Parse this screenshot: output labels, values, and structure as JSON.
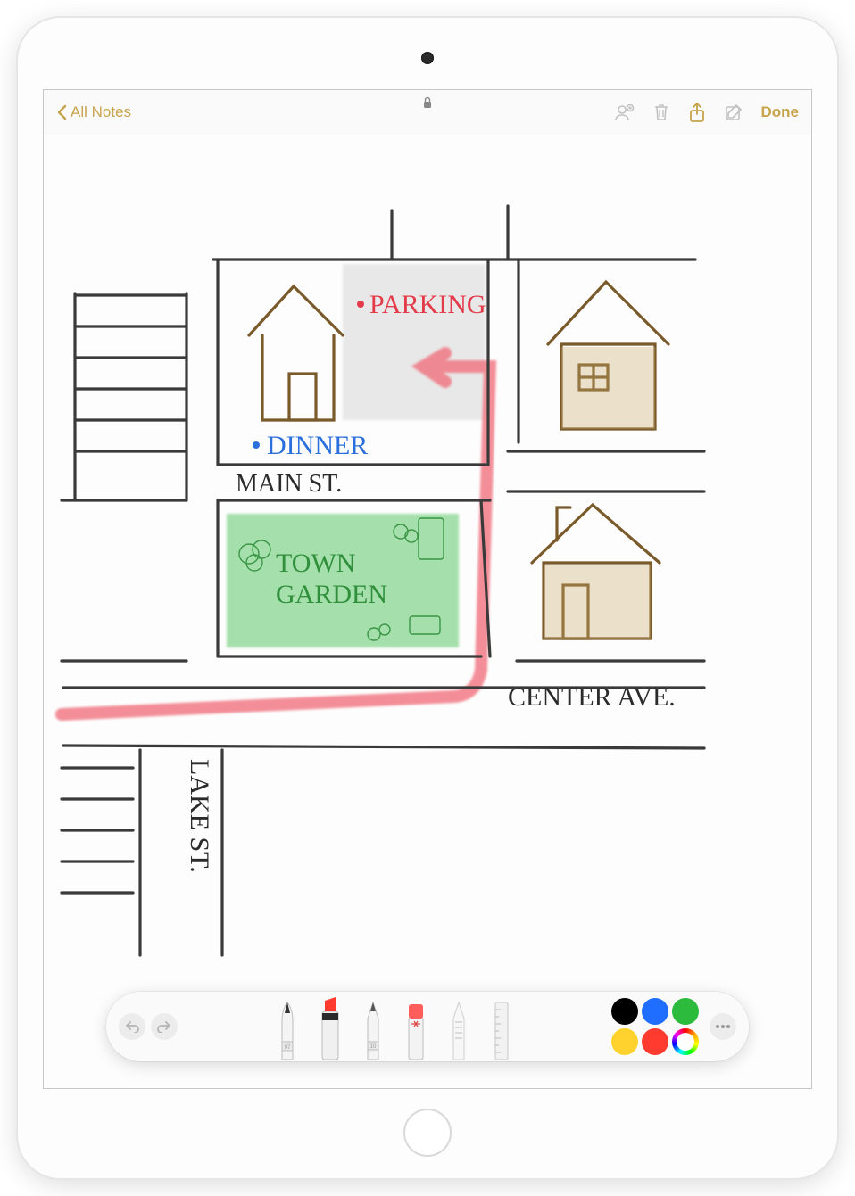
{
  "toolbar": {
    "back_label": "All Notes",
    "done_label": "Done"
  },
  "drawing": {
    "labels": {
      "parking": "PARKING",
      "dinner": "DINNER",
      "main_st": "MAIN ST.",
      "town_garden_1": "TOWN",
      "town_garden_2": "GARDEN",
      "center_ave": "CENTER AVE.",
      "lake_st": "LAKE ST."
    },
    "colors": {
      "parking_text": "#e43b4a",
      "dinner_text": "#2a6fdc",
      "town_text": "#2f8f3a",
      "road": "#3a3a3a",
      "highlighter": "#f06a77",
      "grass": "#5ec86b",
      "house": "#7a5a2a",
      "gray_fill": "#d8d8d8"
    }
  },
  "draw_toolbar": {
    "tools": [
      "pen",
      "marker",
      "pencil",
      "eraser",
      "lasso",
      "ruler"
    ],
    "colors": [
      "#000000",
      "#1f6eff",
      "#2dbb3e",
      "#ffd22e",
      "#ff3b30",
      "multi"
    ]
  }
}
